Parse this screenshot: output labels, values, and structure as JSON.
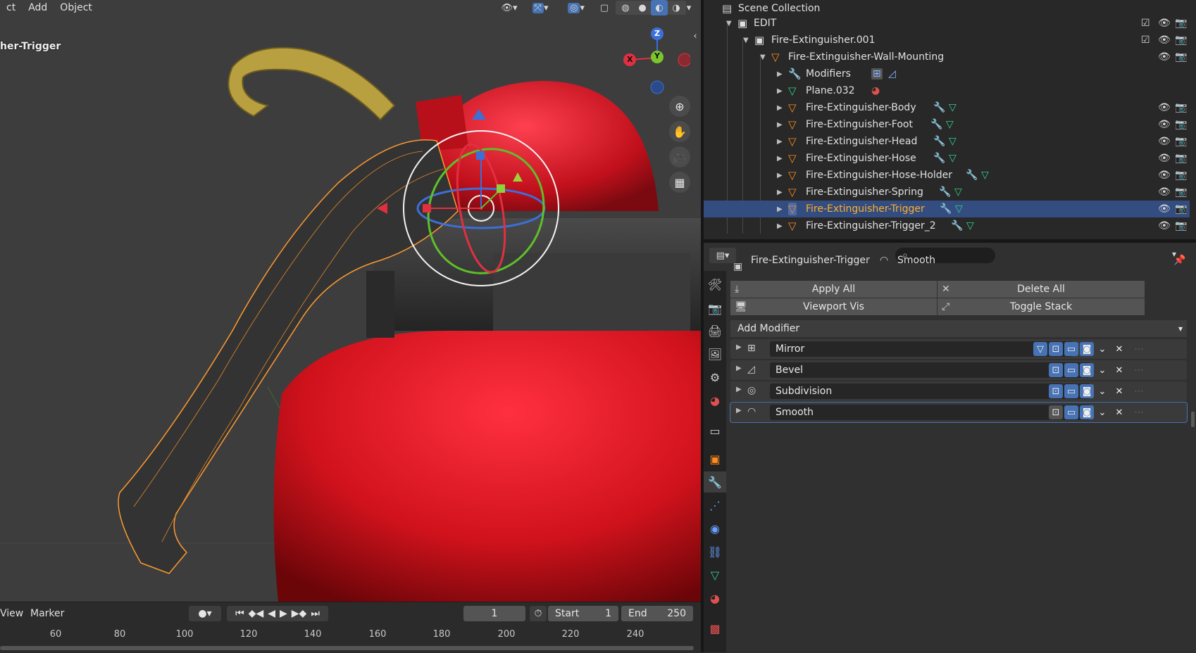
{
  "viewport": {
    "menu": [
      "ct",
      "Add",
      "Object"
    ],
    "active_object_label": "her-Trigger",
    "gizmo_axes": {
      "z": "Z",
      "y": "Y",
      "x": "X"
    }
  },
  "timeline": {
    "menu": [
      "View",
      "Marker"
    ],
    "current_frame": "1",
    "start_label": "Start",
    "start_value": "1",
    "end_label": "End",
    "end_value": "250",
    "ruler_ticks": [
      "60",
      "80",
      "100",
      "120",
      "140",
      "160",
      "180",
      "200",
      "220",
      "240"
    ]
  },
  "outliner": {
    "root": "Scene Collection",
    "collection": "EDIT",
    "parent": "Fire-Extinguisher.001",
    "object": "Fire-Extinguisher-Wall-Mounting",
    "modifiers_label": "Modifiers",
    "mesh_data": "Plane.032",
    "children": [
      {
        "name": "Fire-Extinguisher-Body",
        "selected": false
      },
      {
        "name": "Fire-Extinguisher-Foot",
        "selected": false
      },
      {
        "name": "Fire-Extinguisher-Head",
        "selected": false
      },
      {
        "name": "Fire-Extinguisher-Hose",
        "selected": false
      },
      {
        "name": "Fire-Extinguisher-Hose-Holder",
        "selected": false
      },
      {
        "name": "Fire-Extinguisher-Spring",
        "selected": false
      },
      {
        "name": "Fire-Extinguisher-Trigger",
        "selected": true
      },
      {
        "name": "Fire-Extinguisher-Trigger_2",
        "selected": false
      }
    ]
  },
  "properties": {
    "breadcrumb_object": "Fire-Extinguisher-Trigger",
    "breadcrumb_modifier": "Smooth",
    "apply_all": "Apply All",
    "delete_all": "Delete All",
    "viewport_vis": "Viewport Vis",
    "toggle_stack": "Toggle Stack",
    "add_modifier": "Add Modifier",
    "modifiers": [
      {
        "name": "Mirror"
      },
      {
        "name": "Bevel"
      },
      {
        "name": "Subdivision"
      },
      {
        "name": "Smooth"
      }
    ]
  },
  "colors": {
    "selection": "#334d80",
    "accent_blue": "#4772b3",
    "object_orange": "#ff8c1a",
    "mesh_green": "#2fd18c",
    "extinguisher_red": "#c8141c"
  }
}
